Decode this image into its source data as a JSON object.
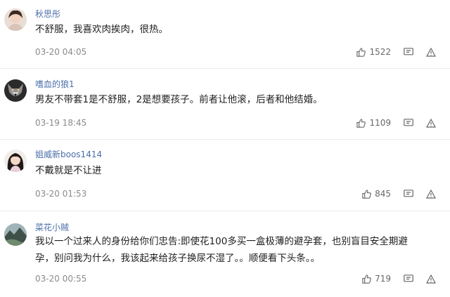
{
  "comments": [
    {
      "username": "秋思彤",
      "content": "不舒服，我喜欢肉挨肉，很热。",
      "time": "03-20 04:05",
      "likes": "1522",
      "avatar_icon": "avatar-woman-icon"
    },
    {
      "username": "嗜血的狼1",
      "content": "男友不带套1是不舒服，2是想要孩子。前者让他滚，后者和他结婚。",
      "time": "03-19 18:45",
      "likes": "1109",
      "avatar_icon": "avatar-wolf-icon"
    },
    {
      "username": "姐威新boos1414",
      "content": "不戴就是不让进",
      "time": "03-20 01:53",
      "likes": "845",
      "avatar_icon": "avatar-girl-icon"
    },
    {
      "username": "菜花小贼",
      "content": "我以一个过来人的身份给你们忠告:即使花100多买一盒极薄的避孕套，也别盲目安全期避孕，别问我为什么，我该起来给孩子换尿不湿了。。顺便看下头条。。",
      "time": "03-20 00:55",
      "likes": "719",
      "avatar_icon": "avatar-landscape-icon"
    }
  ],
  "icons": {
    "like": "thumbs-up-icon",
    "reply": "comment-icon",
    "report": "warning-icon"
  },
  "colors": {
    "username": "#4a6ea9",
    "meta": "#8a8a8a"
  }
}
